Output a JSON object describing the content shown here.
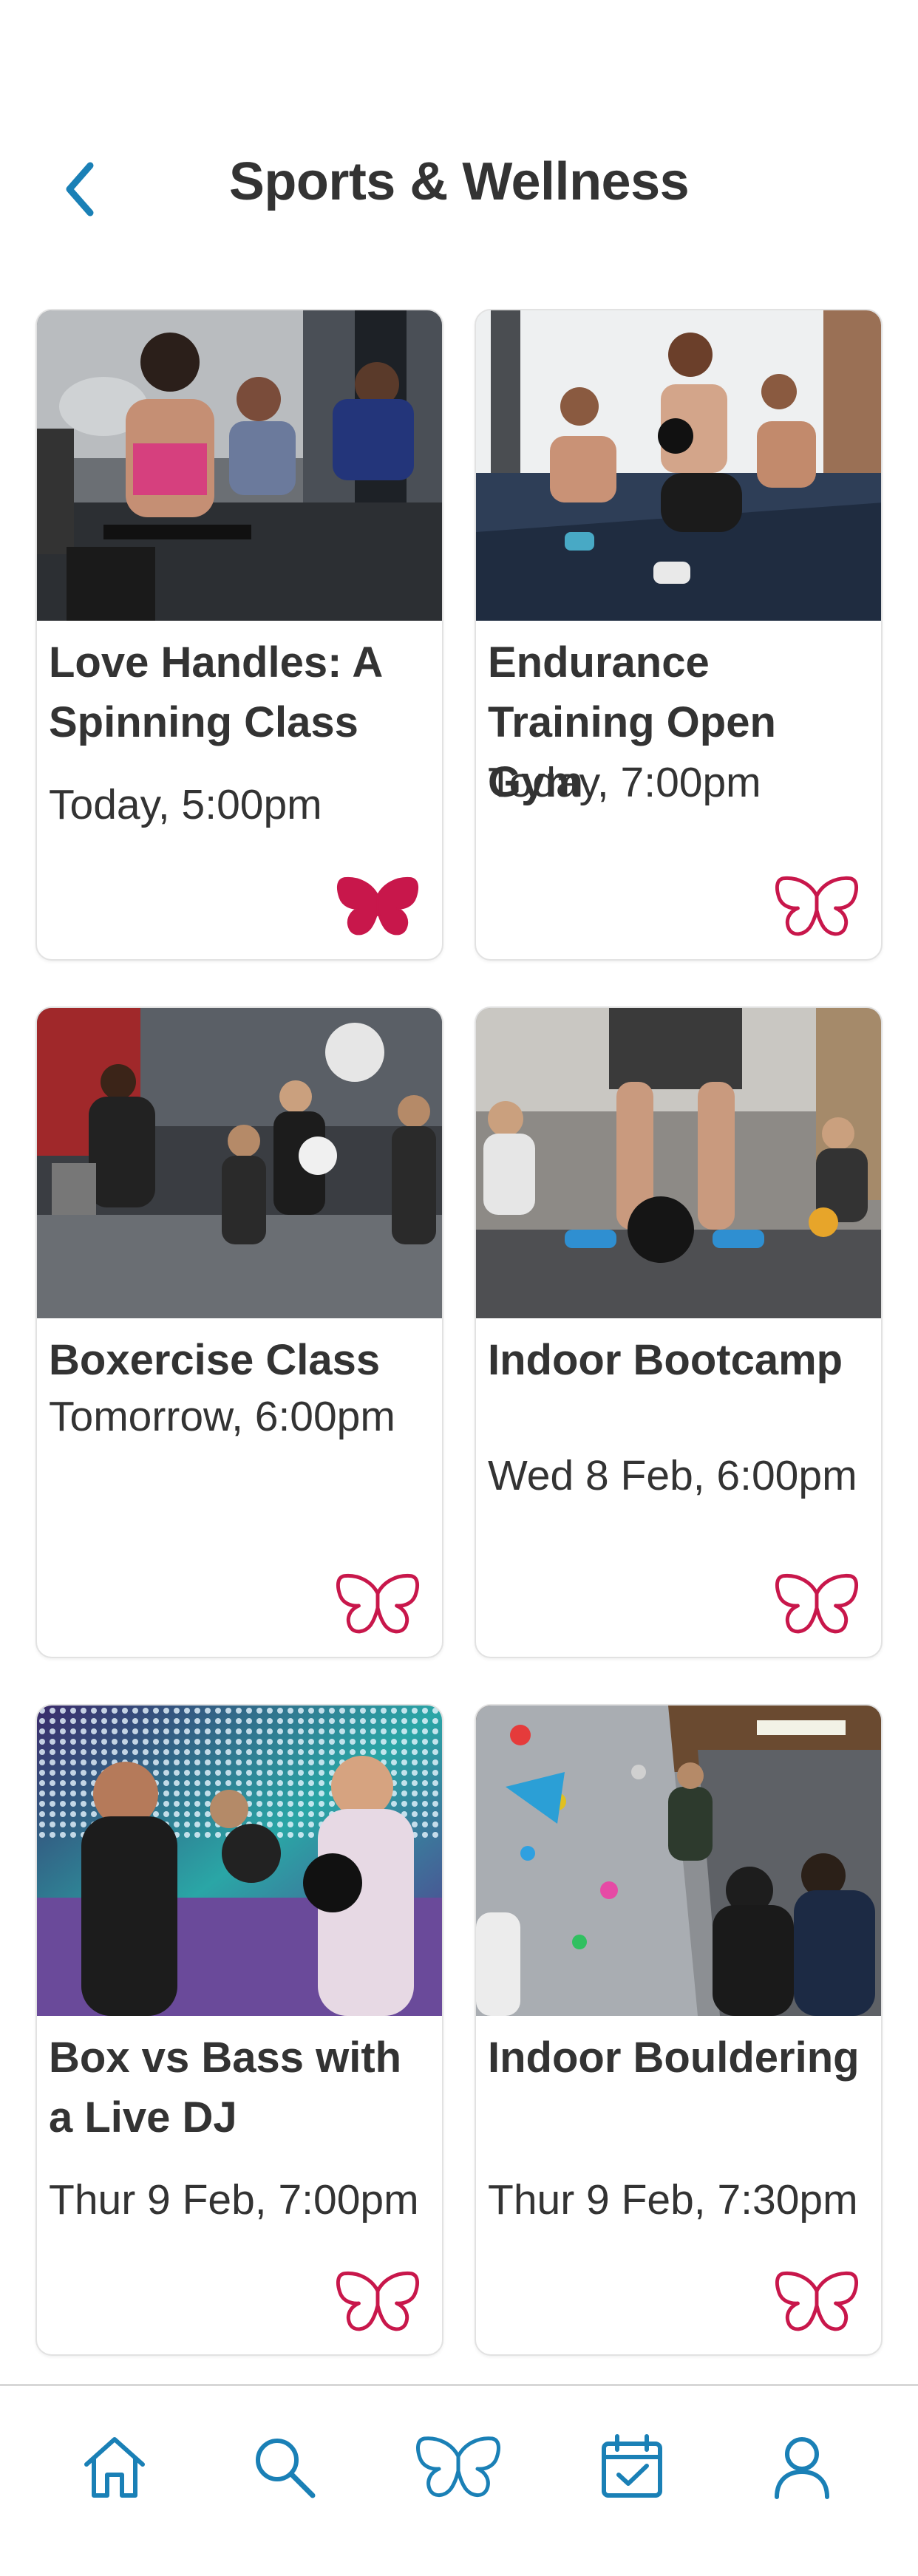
{
  "header": {
    "title": "Sports & Wellness",
    "back_icon": "chevron-left-icon"
  },
  "colors": {
    "accent_blue": "#1a80b6",
    "favorite_red": "#c8174b",
    "text": "#333333",
    "card_border": "#e2e2e2"
  },
  "cards": [
    {
      "title": "Love Handles: A Spinning Class",
      "when": "Today, 5:00pm",
      "image": "spinning class photo",
      "favorited": true
    },
    {
      "title": "Endurance Training Open Gym",
      "when": "Today, 7:00pm",
      "image": "kettlebell squat photo",
      "favorited": false
    },
    {
      "title": "Boxercise Class",
      "when": "Tomorrow, 6:00pm",
      "image": "boxing class photo",
      "favorited": false
    },
    {
      "title": "Indoor Bootcamp",
      "when": "Wed 8 Feb, 6:00pm",
      "image": "kettlebell bootcamp photo",
      "favorited": false
    },
    {
      "title": "Box vs Bass with a Live DJ",
      "when": "Thur 9 Feb, 7:00pm",
      "image": "boxing with DJ lights photo",
      "favorited": false
    },
    {
      "title": "Indoor Bouldering",
      "when": "Thur 9 Feb, 7:30pm",
      "image": "climbing wall photo",
      "favorited": false
    }
  ],
  "bottom_nav": [
    {
      "name": "home",
      "icon": "home-icon"
    },
    {
      "name": "search",
      "icon": "search-icon"
    },
    {
      "name": "favorites",
      "icon": "butterfly-icon"
    },
    {
      "name": "bookings",
      "icon": "calendar-check-icon"
    },
    {
      "name": "profile",
      "icon": "user-icon"
    }
  ]
}
